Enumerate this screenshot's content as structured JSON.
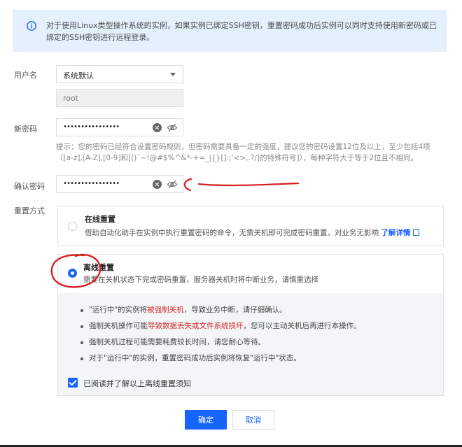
{
  "info": {
    "text": "对于使用Linux类型操作系统的实例，如果实例已绑定SSH密钥，重置密码成功后实例可以同时支持使用新密码或已绑定的SSH密钥进行远程登录。",
    "icon": "info-icon"
  },
  "form": {
    "username_label": "用户名",
    "username_select_value": "系统默认",
    "username_value": "root",
    "new_password_label": "新密码",
    "new_password_mask": "••••••••••••••••",
    "hint": "提示：您的密码已经符合设置密码规则，但密码需要具备一定的强度，建议您的密码设置12位及以上，至少包括4项（[a-z],[A-Z],[0-9]和[()`~!@#$%^&*-+=_|{}[]:;'<>,.?/]的特殊符号]），每种字符大于等于2位且不相同。",
    "confirm_password_label": "确认密码",
    "confirm_password_mask": "••••••••••••••••",
    "reset_method_label": "重置方式"
  },
  "options": {
    "online": {
      "title": "在线重置",
      "desc": "借助自动化助手在实例中执行重置密码的命令，无需关机即可完成密码重置，对业务无影响",
      "link": "了解详情"
    },
    "offline": {
      "title": "离线重置",
      "desc": "需要在关机状态下完成密码重置，服务器关机时将中断业务，请慎重选择",
      "notes": [
        {
          "a": "\"运行中\"的实例将",
          "b": "被强制关机",
          "c": "，导致业务中断，请仔细确认。"
        },
        {
          "a": "强制关机操作可能",
          "b": "导致数据丢失或文件系统损坏",
          "c": "，您可以主动关机后再进行本操作。"
        },
        {
          "a": "强制关机过程可能需要耗费较长时间，请您耐心等待。",
          "b": "",
          "c": ""
        },
        {
          "a": "对于\"运行中\"的实例，重置密码成功后实例将恢复\"运行中\"状态。",
          "b": "",
          "c": ""
        }
      ],
      "agree": "已阅读并了解以上离线重置须知"
    }
  },
  "buttons": {
    "confirm": "确定",
    "cancel": "取消"
  },
  "colors": {
    "primary": "#1664ff",
    "banner_bg": "#e5f0fd",
    "warning_text": "#d42a2a",
    "annotation": "#d62020"
  }
}
